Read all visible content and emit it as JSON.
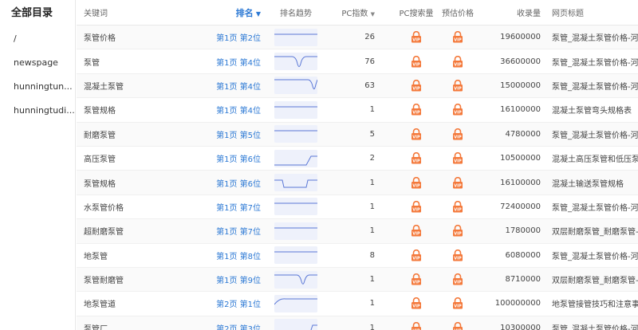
{
  "sidebar": {
    "title": "全部目录",
    "items": [
      "/",
      "newspage",
      "hunningtun...",
      "hunningtudi..."
    ]
  },
  "table": {
    "headers": {
      "keyword": "关键词",
      "rank": "排名",
      "trend": "排名趋势",
      "pc_index": "PC指数",
      "pc_search": "PC搜索量",
      "est_price": "预估价格",
      "indexed": "收录量",
      "page_title": "网页标题"
    },
    "rows": [
      {
        "keyword": "泵管价格",
        "rank": "第1页 第2位",
        "pc_index": "26",
        "indexed": "19600000",
        "title": "泵管_混凝土泵管价格-河北",
        "trend": "flat"
      },
      {
        "keyword": "泵管",
        "rank": "第1页 第4位",
        "pc_index": "76",
        "indexed": "36600000",
        "title": "泵管_混凝土泵管价格-河北",
        "trend": "dip"
      },
      {
        "keyword": "混凝土泵管",
        "rank": "第1页 第4位",
        "pc_index": "63",
        "indexed": "15000000",
        "title": "泵管_混凝土泵管价格-河北",
        "trend": "dip2"
      },
      {
        "keyword": "泵管规格",
        "rank": "第1页 第4位",
        "pc_index": "1",
        "indexed": "16100000",
        "title": "混凝土泵管弯头规格表",
        "trend": "flat"
      },
      {
        "keyword": "耐磨泵管",
        "rank": "第1页 第5位",
        "pc_index": "5",
        "indexed": "4780000",
        "title": "泵管_混凝土泵管价格-河北",
        "trend": "flat"
      },
      {
        "keyword": "高压泵管",
        "rank": "第1页 第6位",
        "pc_index": "2",
        "indexed": "10500000",
        "title": "混凝土高压泵管和低压泵管",
        "trend": "rise"
      },
      {
        "keyword": "泵管规格",
        "rank": "第1页 第6位",
        "pc_index": "1",
        "indexed": "16100000",
        "title": "混凝土输送泵管规格",
        "trend": "step"
      },
      {
        "keyword": "水泵管价格",
        "rank": "第1页 第7位",
        "pc_index": "1",
        "indexed": "72400000",
        "title": "泵管_混凝土泵管价格-河北",
        "trend": "flat"
      },
      {
        "keyword": "超耐磨泵管",
        "rank": "第1页 第7位",
        "pc_index": "1",
        "indexed": "1780000",
        "title": "双层耐磨泵管_耐磨泵管-河",
        "trend": "flat"
      },
      {
        "keyword": "地泵管",
        "rank": "第1页 第8位",
        "pc_index": "8",
        "indexed": "6080000",
        "title": "泵管_混凝土泵管价格-河北",
        "trend": "flat"
      },
      {
        "keyword": "泵管耐磨管",
        "rank": "第1页 第9位",
        "pc_index": "1",
        "indexed": "8710000",
        "title": "双层耐磨泵管_耐磨泵管-河",
        "trend": "dip3"
      },
      {
        "keyword": "地泵管道",
        "rank": "第2页 第1位",
        "pc_index": "1",
        "indexed": "100000000",
        "title": "地泵管接管技巧和注意事项",
        "trend": "fall"
      },
      {
        "keyword": "泵管厂",
        "rank": "第2页 第3位",
        "pc_index": "1",
        "indexed": "10300000",
        "title": "泵管_混凝土泵管价格-河北",
        "trend": "riseend"
      }
    ]
  },
  "colors": {
    "accent": "#2b78d4",
    "vip": "#f4793b",
    "spark_bg": "#eef1fb",
    "spark_line": "#5b78d6"
  },
  "icons": {
    "vip": "vip-lock-icon",
    "sort": "caret-down-icon"
  }
}
